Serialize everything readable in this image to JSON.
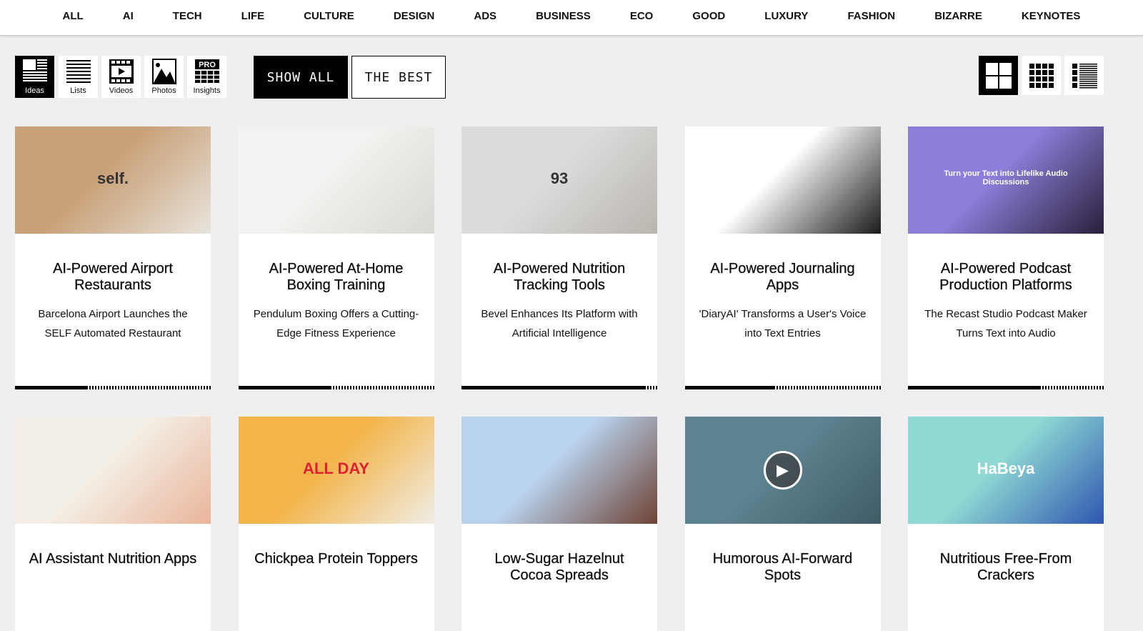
{
  "nav": [
    "ALL",
    "AI",
    "TECH",
    "LIFE",
    "CULTURE",
    "DESIGN",
    "ADS",
    "BUSINESS",
    "ECO",
    "GOOD",
    "LUXURY",
    "FASHION",
    "BIZARRE",
    "KEYNOTES"
  ],
  "types": [
    {
      "label": "Ideas",
      "icon": "ideas-icon",
      "active": true
    },
    {
      "label": "Lists",
      "icon": "lists-icon"
    },
    {
      "label": "Videos",
      "icon": "videos-icon"
    },
    {
      "label": "Photos",
      "icon": "photos-icon"
    },
    {
      "label": "Insights",
      "icon": "pro-insights-icon",
      "badge": "PRO"
    }
  ],
  "filters": {
    "show_all": "SHOW ALL",
    "the_best": "THE BEST",
    "active": "SHOW ALL"
  },
  "views": [
    {
      "icon": "large-grid-icon",
      "active": true
    },
    {
      "icon": "small-grid-icon"
    },
    {
      "icon": "list-view-icon"
    }
  ],
  "cards": [
    {
      "title": "AI-Powered Airport Restaurants",
      "desc": "Barcelona Airport Launches the SELF Automated Restaurant",
      "progress": 0.37,
      "image_colors": [
        "#c9a27a",
        "#e8e4dc"
      ],
      "image_text": "self."
    },
    {
      "title": "AI-Powered At-Home Boxing Training",
      "desc": "Pendulum Boxing Offers a Cutting-Edge Fitness Experience",
      "progress": 0.47,
      "image_colors": [
        "#f2f2f0",
        "#d8d8d4"
      ]
    },
    {
      "title": "AI-Powered Nutrition Tracking Tools",
      "desc": "Bevel Enhances Its Platform with Artificial Intelligence",
      "progress": 0.94,
      "image_colors": [
        "#dcdcdc",
        "#b9b5ae"
      ],
      "image_text": "93"
    },
    {
      "title": "AI-Powered Journaling Apps",
      "desc": "'DiaryAI' Transforms a User's Voice into Text Entries",
      "progress": 0.46,
      "image_colors": [
        "#ffffff",
        "#1a1a1a"
      ]
    },
    {
      "title": "AI-Powered Podcast Production Platforms",
      "desc": "The Recast Studio Podcast Maker Turns Text into Audio",
      "progress": 0.68,
      "image_colors": [
        "#8b7fd9",
        "#2a1f3a"
      ],
      "image_text": "Turn your Text into Lifelike Audio Discussions"
    },
    {
      "title": "AI Assistant Nutrition Apps",
      "image_colors": [
        "#f4efe6",
        "#e9b59a"
      ]
    },
    {
      "title": "Chickpea Protein Toppers",
      "image_colors": [
        "#f3b54a",
        "#f0ede6"
      ],
      "image_text": "ALL DAY"
    },
    {
      "title": "Low-Sugar Hazelnut Cocoa Spreads",
      "image_colors": [
        "#b9d3ef",
        "#6e4234"
      ]
    },
    {
      "title": "Humorous AI-Forward Spots",
      "image_colors": [
        "#5e8390",
        "#3f5c66"
      ],
      "video": true
    },
    {
      "title": "Nutritious Free-From Crackers",
      "image_colors": [
        "#8fd8d3",
        "#2e56b0"
      ],
      "image_text": "HaBeya"
    }
  ]
}
